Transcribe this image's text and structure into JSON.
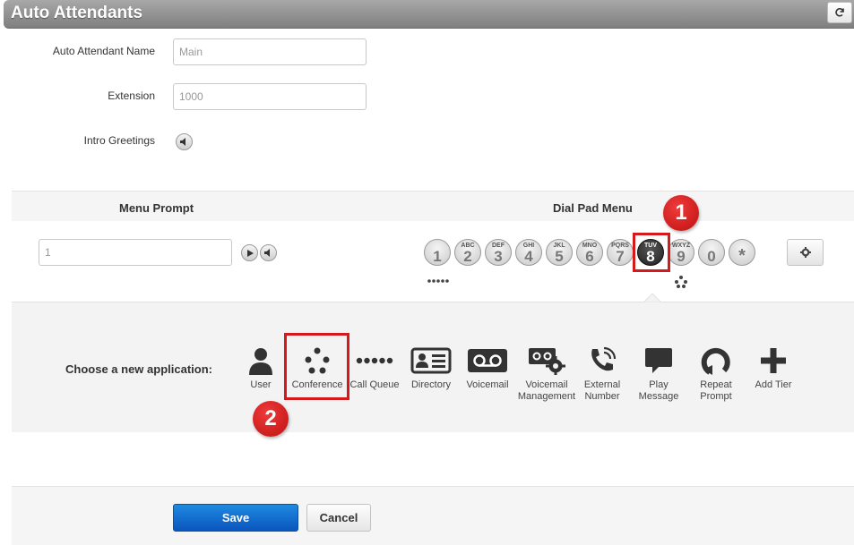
{
  "header": {
    "title": "Auto Attendants",
    "refresh_icon": "refresh-icon"
  },
  "form": {
    "name_label": "Auto Attendant Name",
    "name_value": "Main",
    "extension_label": "Extension",
    "extension_value": "1000",
    "greetings_label": "Intro Greetings"
  },
  "section": {
    "menu_prompt_heading": "Menu Prompt",
    "dial_pad_heading": "Dial Pad Menu"
  },
  "menu_prompt": {
    "value": "1"
  },
  "dial_pad": {
    "keys": [
      {
        "letters": "",
        "digit": "1"
      },
      {
        "letters": "ABC",
        "digit": "2"
      },
      {
        "letters": "DEF",
        "digit": "3"
      },
      {
        "letters": "GHI",
        "digit": "4"
      },
      {
        "letters": "JKL",
        "digit": "5"
      },
      {
        "letters": "MNO",
        "digit": "6"
      },
      {
        "letters": "PQRS",
        "digit": "7"
      },
      {
        "letters": "TUV",
        "digit": "8"
      },
      {
        "letters": "WXYZ",
        "digit": "9"
      },
      {
        "letters": "",
        "digit": "0"
      },
      {
        "letters": "",
        "digit": "*"
      }
    ],
    "active_key": "8"
  },
  "annotations": {
    "badge1": "1",
    "badge2": "2"
  },
  "applications": {
    "prompt": "Choose a new application:",
    "items": [
      {
        "label": "User",
        "icon": "user-icon"
      },
      {
        "label": "Conference",
        "icon": "conference-icon"
      },
      {
        "label": "Call Queue",
        "icon": "call-queue-icon"
      },
      {
        "label": "Directory",
        "icon": "directory-icon"
      },
      {
        "label": "Voicemail",
        "icon": "voicemail-icon"
      },
      {
        "label": "Voicemail Management",
        "line1": "Voicemail",
        "line2": "Management",
        "icon": "voicemail-management-icon"
      },
      {
        "label": "External Number",
        "line1": "External",
        "line2": "Number",
        "icon": "external-number-icon"
      },
      {
        "label": "Play Message",
        "line1": "Play",
        "line2": "Message",
        "icon": "play-message-icon"
      },
      {
        "label": "Repeat Prompt",
        "line1": "Repeat",
        "line2": "Prompt",
        "icon": "repeat-prompt-icon"
      },
      {
        "label": "Add Tier",
        "icon": "add-tier-icon"
      }
    ]
  },
  "footer": {
    "save_label": "Save",
    "cancel_label": "Cancel"
  },
  "colors": {
    "accent": "#1e8ae0",
    "highlight": "#d6191b",
    "title_bar": "#8f8f8f"
  }
}
